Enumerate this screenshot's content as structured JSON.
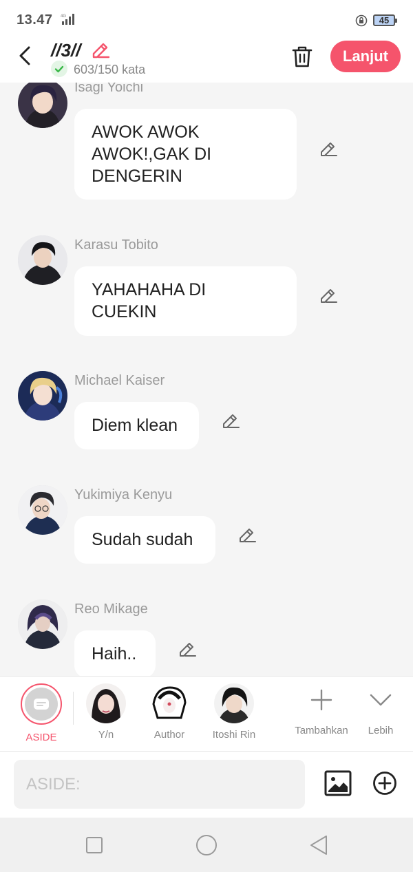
{
  "status_bar": {
    "time": "13.47",
    "network": "4G",
    "battery": "45"
  },
  "header": {
    "title": "//3//",
    "word_count": "603/150 kata",
    "next_button": "Lanjut"
  },
  "messages": [
    {
      "name": "Isagi Yoichi",
      "text": "AWOK AWOK\nAWOK!,GAK DI\nDENGERIN"
    },
    {
      "name": "Karasu Tobito",
      "text": "YAHAHAHA DI\nCUEKIN"
    },
    {
      "name": "Michael Kaiser",
      "text": "Diem klean"
    },
    {
      "name": "Yukimiya Kenyu",
      "text": "Sudah sudah"
    },
    {
      "name": "Reo Mikage",
      "text": "Haih.."
    }
  ],
  "characters": {
    "aside": "ASIDE",
    "yn": "Y/n",
    "author": "Author",
    "rin": "Itoshi Rin",
    "add": "Tambahkan",
    "more": "Lebih"
  },
  "input": {
    "placeholder": "ASIDE:",
    "value": ""
  },
  "colors": {
    "accent": "#f5546c",
    "background": "#f5f5f5",
    "bubble": "#ffffff",
    "check": "#3cb84a"
  }
}
